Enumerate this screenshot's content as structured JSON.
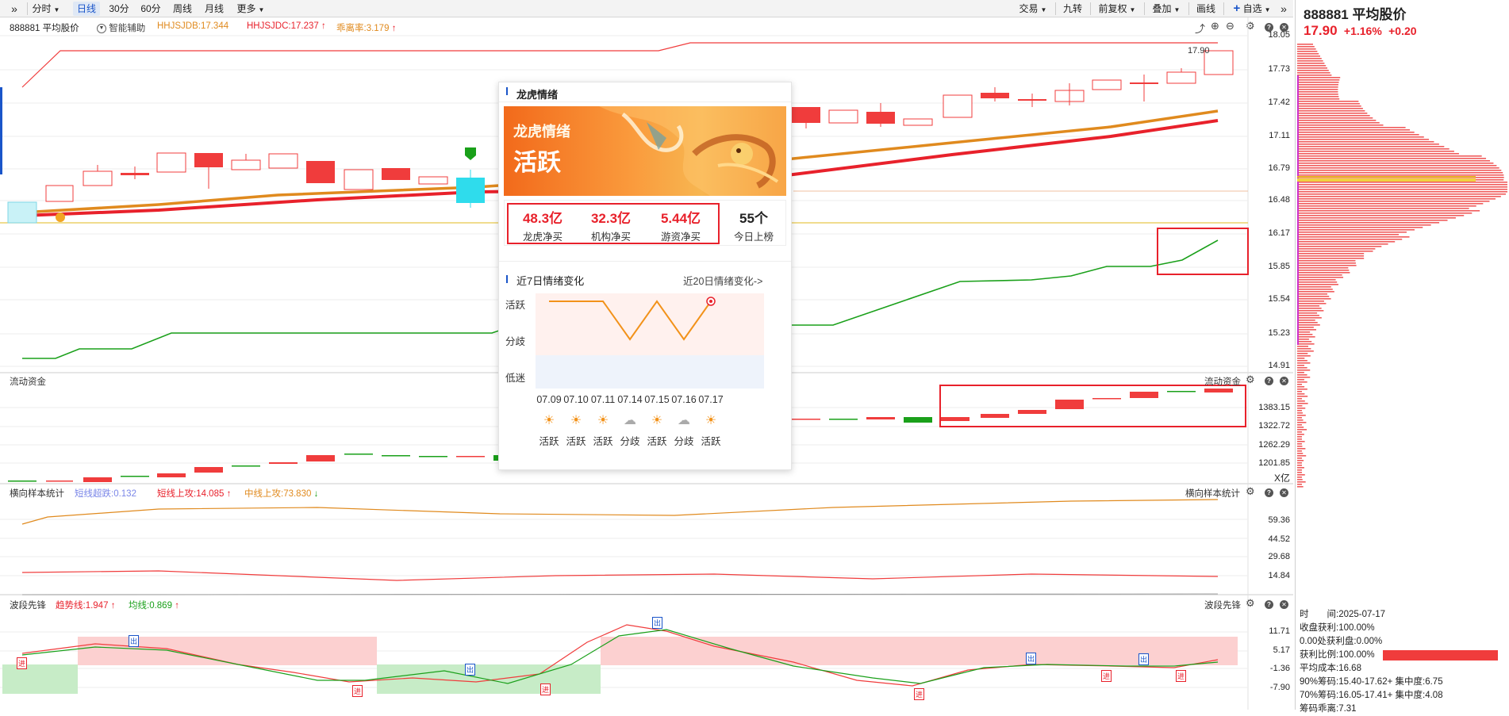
{
  "toolbar": {
    "left": [
      {
        "label": "分时",
        "dropdown": true
      },
      {
        "label": "日线",
        "active": true
      },
      {
        "label": "30分"
      },
      {
        "label": "60分"
      },
      {
        "label": "周线"
      },
      {
        "label": "月线"
      },
      {
        "label": "更多",
        "dropdown": true
      }
    ],
    "right": [
      {
        "label": "交易",
        "dropdown": true
      },
      {
        "label": "九转"
      },
      {
        "label": "前复权",
        "dropdown": true
      },
      {
        "label": "叠加",
        "dropdown": true
      },
      {
        "label": "画线"
      },
      {
        "label": "自选",
        "dropdown": true
      }
    ]
  },
  "main_panel": {
    "title": "888881 平均股价",
    "assist": "智能辅助",
    "ind1": "HHJSJDB:17.344",
    "ind2": "HHJSJDC:17.237",
    "ind3": "乖离率:3.179",
    "axis": [
      "18.05",
      "17.73",
      "17.42",
      "17.11",
      "16.79",
      "16.48",
      "16.17",
      "15.85",
      "15.54",
      "15.23",
      "14.91"
    ],
    "last_price": "17.90"
  },
  "flow_panel": {
    "title": "流动资金",
    "title_right": "流动资金",
    "axis": [
      "1383.15",
      "1322.72",
      "1262.29",
      "1201.85"
    ],
    "unit": "X亿"
  },
  "hstat_panel": {
    "title": "横向样本统计",
    "title_right": "横向样本统计",
    "ind1": "短线超跌:0.132",
    "ind2": "短线上攻:14.085",
    "ind3": "中线上攻:73.830",
    "axis": [
      "59.36",
      "44.52",
      "29.68",
      "14.84"
    ]
  },
  "wave_panel": {
    "title": "波段先锋",
    "title_right": "波段先锋",
    "ind1": "趋势线:1.947",
    "ind2": "均线:0.869",
    "axis": [
      "11.71",
      "5.17",
      "-1.36",
      "-7.90"
    ],
    "marker_in": "进",
    "marker_out": "出"
  },
  "right_panel": {
    "code_name": "888881 平均股价",
    "price": "17.90",
    "change_pct": "+1.16%",
    "change": "+0.20",
    "info": [
      "时　　间:2025-07-17",
      "收盘获利:100.00%",
      "0.00处获利盘:0.00%",
      "获利比例:100.00%",
      "平均成本:16.68",
      "90%筹码:15.40-17.62+ 集中度:6.75",
      "70%筹码:16.05-17.41+ 集中度:4.08",
      "筹码乖离:7.31"
    ]
  },
  "popup": {
    "header": "龙虎情绪",
    "banner_title": "龙虎情绪",
    "banner_status": "活跃",
    "stats": [
      {
        "value": "48.3亿",
        "label": "龙虎净买"
      },
      {
        "value": "32.3亿",
        "label": "机构净买"
      },
      {
        "value": "5.44亿",
        "label": "游资净买"
      },
      {
        "value": "55个",
        "label": "今日上榜"
      }
    ],
    "trend_title": "近7日情绪变化",
    "trend_link": "近20日情绪变化->",
    "levels": [
      "活跃",
      "分歧",
      "低迷"
    ],
    "dates": [
      "07.09",
      "07.10",
      "07.11",
      "07.14",
      "07.15",
      "07.16",
      "07.17"
    ],
    "daily": [
      "活跃",
      "活跃",
      "活跃",
      "分歧",
      "活跃",
      "分歧",
      "活跃"
    ]
  },
  "colors": {
    "up": "#f03c3c",
    "down": "#1aa01a",
    "accent": "#1a55c9",
    "orange": "#e08a1e",
    "highlight_box": "#e8212b"
  }
}
